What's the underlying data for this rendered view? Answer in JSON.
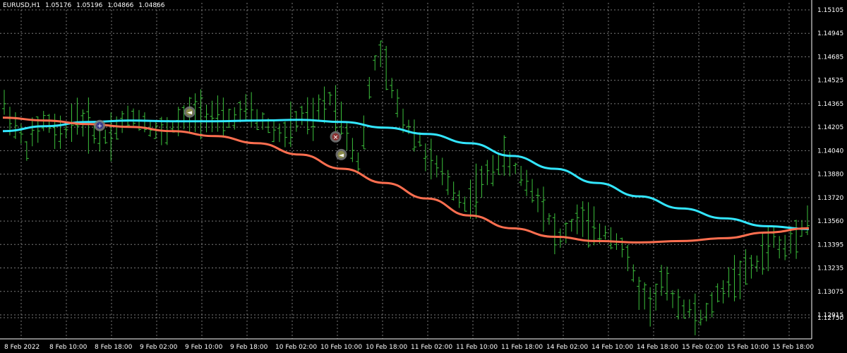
{
  "header": {
    "symbol": "EURUSD,H1",
    "open": "1.05176",
    "high": "1.05196",
    "low": "1.04866",
    "close": "1.04866"
  },
  "colors": {
    "background": "#000000",
    "grid": "#7a7a7a",
    "bars": "#3cc13c",
    "fast_ma": "#33e6ff",
    "slow_ma": "#ff6f50",
    "axis_text": "#ffffff"
  },
  "chart_data": {
    "type": "line",
    "title": "EURUSD,H1",
    "grid": true,
    "ylim": [
      1.1275,
      1.1512
    ],
    "y_ticks": [
      "1.15105",
      "1.14945",
      "1.14685",
      "1.14525",
      "1.14365",
      "1.14205",
      "1.14040",
      "1.13880",
      "1.13720",
      "1.13560",
      "1.13395",
      "1.13235",
      "1.13075",
      "1.12915",
      "1.12750"
    ],
    "x_ticks": [
      "8 Feb 2022",
      "8 Feb 10:00",
      "8 Feb 18:00",
      "9 Feb 02:00",
      "9 Feb 10:00",
      "9 Feb 18:00",
      "10 Feb 02:00",
      "10 Feb 10:00",
      "10 Feb 18:00",
      "11 Feb 02:00",
      "11 Feb 10:00",
      "11 Feb 18:00",
      "14 Feb 02:00",
      "14 Feb 10:00",
      "14 Feb 18:00",
      "15 Feb 02:00",
      "15 Feb 10:00",
      "15 Feb 18:00"
    ],
    "bar_count": 144,
    "bars_anchor": [
      1.144,
      1.1432,
      1.1425,
      1.1418,
      1.141,
      1.1418,
      1.1422,
      1.1428,
      1.1426,
      1.142,
      1.1418,
      1.1422,
      1.1428,
      1.1432,
      1.1428,
      1.1425,
      1.1422,
      1.1418,
      1.1418,
      1.142,
      1.1424,
      1.1428,
      1.143,
      1.1432,
      1.143,
      1.1428,
      1.1425,
      1.1422,
      1.142,
      1.1422,
      1.1425,
      1.1428,
      1.143,
      1.1432,
      1.1435,
      1.1436,
      1.1434,
      1.1432,
      1.143,
      1.1428,
      1.143,
      1.1432,
      1.1434,
      1.1436,
      1.1434,
      1.143,
      1.1428,
      1.1425,
      1.1422,
      1.142,
      1.142,
      1.1424,
      1.1428,
      1.1432,
      1.143,
      1.1428,
      1.1436,
      1.144,
      1.1445,
      1.144,
      1.143,
      1.142,
      1.141,
      1.14,
      1.142,
      1.145,
      1.147,
      1.1475,
      1.1465,
      1.145,
      1.144,
      1.143,
      1.1425,
      1.142,
      1.1415,
      1.1405,
      1.14,
      1.1395,
      1.139,
      1.1385,
      1.138,
      1.1375,
      1.137,
      1.1375,
      1.138,
      1.1385,
      1.139,
      1.1395,
      1.14,
      1.1402,
      1.1398,
      1.1395,
      1.139,
      1.1385,
      1.138,
      1.1375,
      1.137,
      1.136,
      1.135,
      1.1345,
      1.135,
      1.1355,
      1.136,
      1.1358,
      1.1355,
      1.135,
      1.135,
      1.135,
      1.1348,
      1.1345,
      1.134,
      1.133,
      1.132,
      1.131,
      1.1305,
      1.13,
      1.1305,
      1.1315,
      1.131,
      1.1305,
      1.13,
      1.1298,
      1.1295,
      1.1292,
      1.129,
      1.1292,
      1.13,
      1.1305,
      1.131,
      1.1315,
      1.1318,
      1.132,
      1.1322,
      1.1325,
      1.1328,
      1.1335,
      1.134,
      1.1345,
      1.134,
      1.1338,
      1.1345,
      1.135,
      1.1355,
      1.1358,
      1.136,
      1.1358
    ],
    "series": [
      {
        "type": "ma",
        "color": "#33e6ff",
        "values": [
          1.14215,
          1.1425,
          1.1428,
          1.1429,
          1.14285,
          1.14285,
          1.1429,
          1.14295,
          1.1428,
          1.1424,
          1.14195,
          1.1413,
          1.1404,
          1.1395,
          1.1385,
          1.13755,
          1.1367,
          1.136,
          1.13545,
          1.13525
        ]
      },
      {
        "type": "ma",
        "color": "#ff6f50",
        "values": [
          1.1431,
          1.1429,
          1.14265,
          1.14245,
          1.14215,
          1.1418,
          1.1413,
          1.1405,
          1.1395,
          1.1385,
          1.1374,
          1.1362,
          1.1353,
          1.1347,
          1.1344,
          1.1343,
          1.1344,
          1.1346,
          1.135,
          1.1353
        ]
      }
    ],
    "markers": [
      {
        "name": "entry-1",
        "bar": 17,
        "price": 1.14255,
        "kind": "circle-plus",
        "fill": "#3c3c8c",
        "label": "+"
      },
      {
        "name": "arrow-1",
        "bar": 33,
        "price": 1.1435,
        "kind": "triangle",
        "fill": "#8a8a4a",
        "label": "◄"
      },
      {
        "name": "entry-2",
        "bar": 59,
        "price": 1.14175,
        "kind": "circle-x",
        "fill": "#8a3030",
        "label": "✕"
      },
      {
        "name": "arrow-2",
        "bar": 60,
        "price": 1.1405,
        "kind": "triangle",
        "fill": "#8a8a4a",
        "label": "◄"
      }
    ]
  }
}
